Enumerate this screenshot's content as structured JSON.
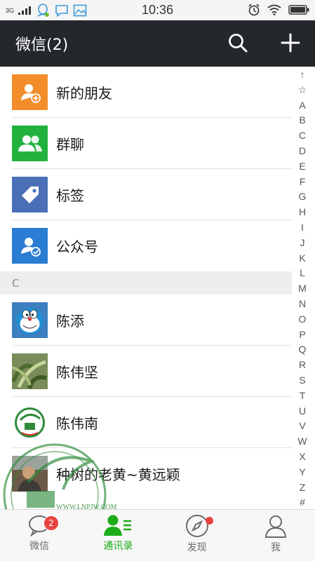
{
  "status": {
    "network": "3G",
    "time": "10:36"
  },
  "header": {
    "title": "微信(2)"
  },
  "top_items": [
    {
      "label": "新的朋友",
      "icon": "add-friend-icon",
      "color": "#f38d2b"
    },
    {
      "label": "群聊",
      "icon": "group-chat-icon",
      "color": "#23b13e"
    },
    {
      "label": "标签",
      "icon": "tag-icon",
      "color": "#4a6fb6"
    },
    {
      "label": "公众号",
      "icon": "official-account-icon",
      "color": "#2b7cd3"
    }
  ],
  "section": {
    "letter": "C"
  },
  "contacts": [
    {
      "name": "陈添",
      "avatar": "doraemon-avatar"
    },
    {
      "name": "陈伟坚",
      "avatar": "plant-avatar"
    },
    {
      "name": "陈伟南",
      "avatar": "logo-avatar"
    },
    {
      "name": "种树的老黄~黄远颖",
      "avatar": "photo-avatar"
    }
  ],
  "index_letters": [
    "↑",
    "☆",
    "A",
    "B",
    "C",
    "D",
    "E",
    "F",
    "G",
    "H",
    "I",
    "J",
    "K",
    "L",
    "M",
    "N",
    "O",
    "P",
    "Q",
    "R",
    "S",
    "T",
    "U",
    "V",
    "W",
    "X",
    "Y",
    "Z",
    "#"
  ],
  "tabs": [
    {
      "label": "微信",
      "badge": "2"
    },
    {
      "label": "通讯录"
    },
    {
      "label": "发现"
    },
    {
      "label": "我"
    }
  ],
  "watermark": {
    "url": "WWW.LNPJW.COM"
  },
  "colors": {
    "accent": "#1aad19",
    "header": "#24272c",
    "badge": "#e64340"
  }
}
